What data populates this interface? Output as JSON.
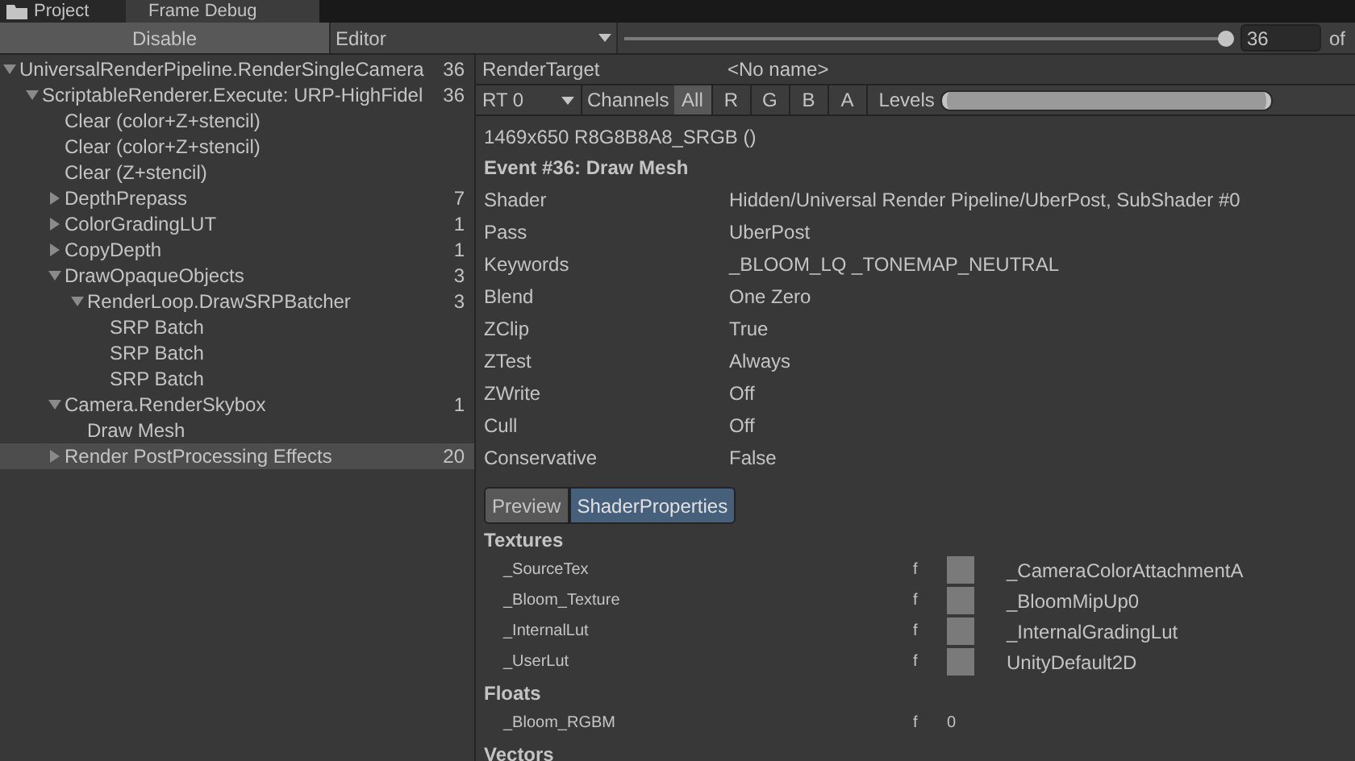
{
  "window_tabs": [
    {
      "label": "Project",
      "selected": false
    },
    {
      "label": "Frame Debug",
      "selected": true
    }
  ],
  "toolbar": {
    "disable_button": "Disable",
    "target_dropdown": "Editor",
    "event_slider": {
      "level": 1
    },
    "event_field": "36",
    "of_label": "of"
  },
  "tree": [
    {
      "label": "UniversalRenderPipeline.RenderSingleCamera",
      "count": "36",
      "expanded": true,
      "selected": false,
      "children": [
        {
          "label": "ScriptableRenderer.Execute: URP-HighFidel",
          "count": "36",
          "expanded": true,
          "selected": false,
          "children": [
            {
              "label": "Clear (color+Z+stencil)",
              "selected": false
            },
            {
              "label": "Clear (color+Z+stencil)",
              "selected": false
            },
            {
              "label": "Clear (Z+stencil)",
              "selected": false
            },
            {
              "label": "DepthPrepass",
              "count": "7",
              "expanded": false,
              "selected": false
            },
            {
              "label": "ColorGradingLUT",
              "count": "1",
              "expanded": false,
              "selected": false
            },
            {
              "label": "CopyDepth",
              "count": "1",
              "expanded": false,
              "selected": false
            },
            {
              "label": "DrawOpaqueObjects",
              "count": "3",
              "expanded": true,
              "selected": false,
              "children": [
                {
                  "label": "RenderLoop.DrawSRPBatcher",
                  "count": "3",
                  "expanded": true,
                  "selected": false,
                  "children": [
                    {
                      "label": "SRP Batch",
                      "selected": false
                    },
                    {
                      "label": "SRP Batch",
                      "selected": false
                    },
                    {
                      "label": "SRP Batch",
                      "selected": false
                    }
                  ]
                }
              ]
            },
            {
              "label": "Camera.RenderSkybox",
              "count": "1",
              "expanded": true,
              "selected": false,
              "children": [
                {
                  "label": "Draw Mesh",
                  "selected": false
                }
              ]
            },
            {
              "label": "Render PostProcessing Effects",
              "count": "20",
              "expanded": false,
              "selected": true
            }
          ]
        }
      ]
    }
  ],
  "render_target": {
    "label": "RenderTarget",
    "value": "<No name>"
  },
  "rt_toolbar": {
    "rt_dropdown": "RT 0",
    "channels_label": "Channels",
    "channels": [
      {
        "label": "All",
        "selected": true
      },
      {
        "label": "R",
        "selected": false
      },
      {
        "label": "G",
        "selected": false
      },
      {
        "label": "B",
        "selected": false
      },
      {
        "label": "A",
        "selected": false
      }
    ],
    "levels_label": "Levels",
    "levels_slider": {
      "level": 1
    }
  },
  "format": "1469x650 R8G8B8A8_SRGB ()",
  "event_title": "Event #36: Draw Mesh",
  "properties": [
    {
      "label": "Shader",
      "value": "Hidden/Universal Render Pipeline/UberPost, SubShader #0"
    },
    {
      "label": "Pass",
      "value": "UberPost"
    },
    {
      "label": "Keywords",
      "value": "_BLOOM_LQ _TONEMAP_NEUTRAL"
    },
    {
      "label": "Blend",
      "value": "One Zero"
    },
    {
      "label": "ZClip",
      "value": "True"
    },
    {
      "label": "ZTest",
      "value": "Always"
    },
    {
      "label": "ZWrite",
      "value": "Off"
    },
    {
      "label": "Cull",
      "value": "Off"
    },
    {
      "label": "Conservative",
      "value": "False"
    }
  ],
  "detail_tabs": [
    {
      "label": "Preview",
      "selected": false
    },
    {
      "label": "ShaderProperties",
      "selected": true
    }
  ],
  "sections": [
    {
      "title": "Textures",
      "rows": [
        {
          "name": "_SourceTex",
          "stage": "f",
          "kind": "texture",
          "value": "_CameraColorAttachmentA"
        },
        {
          "name": "_Bloom_Texture",
          "stage": "f",
          "kind": "texture",
          "value": "_BloomMipUp0"
        },
        {
          "name": "_InternalLut",
          "stage": "f",
          "kind": "texture",
          "value": "_InternalGradingLut"
        },
        {
          "name": "_UserLut",
          "stage": "f",
          "kind": "texture",
          "value": "UnityDefault2D"
        }
      ]
    },
    {
      "title": "Floats",
      "rows": [
        {
          "name": "_Bloom_RGBM",
          "stage": "f",
          "kind": "value",
          "value": "0"
        }
      ]
    },
    {
      "title": "Vectors"
    }
  ]
}
